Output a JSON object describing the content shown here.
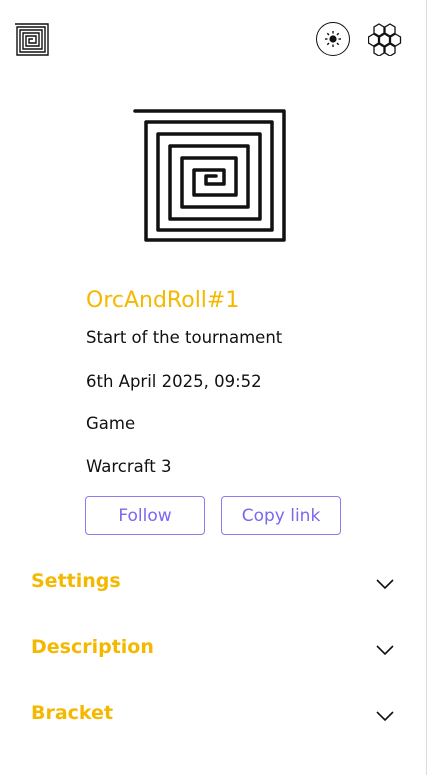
{
  "header": {
    "logo_icon": "spiral-logo-icon",
    "theme_icon": "sun-icon",
    "menu_icon": "hexagon-cluster-icon"
  },
  "tournament": {
    "name": "OrcAndRoll#1",
    "start_label": "Start of the tournament",
    "start_date": "6th April 2025, 09:52",
    "game_label": "Game",
    "game_value": "Warcraft 3"
  },
  "actions": {
    "follow_label": "Follow",
    "copy_link_label": "Copy link"
  },
  "sections": [
    {
      "label": "Settings"
    },
    {
      "label": "Description"
    },
    {
      "label": "Bracket"
    }
  ],
  "colors": {
    "accent": "#f5b800",
    "button": "#7a68ee",
    "text": "#111111"
  }
}
